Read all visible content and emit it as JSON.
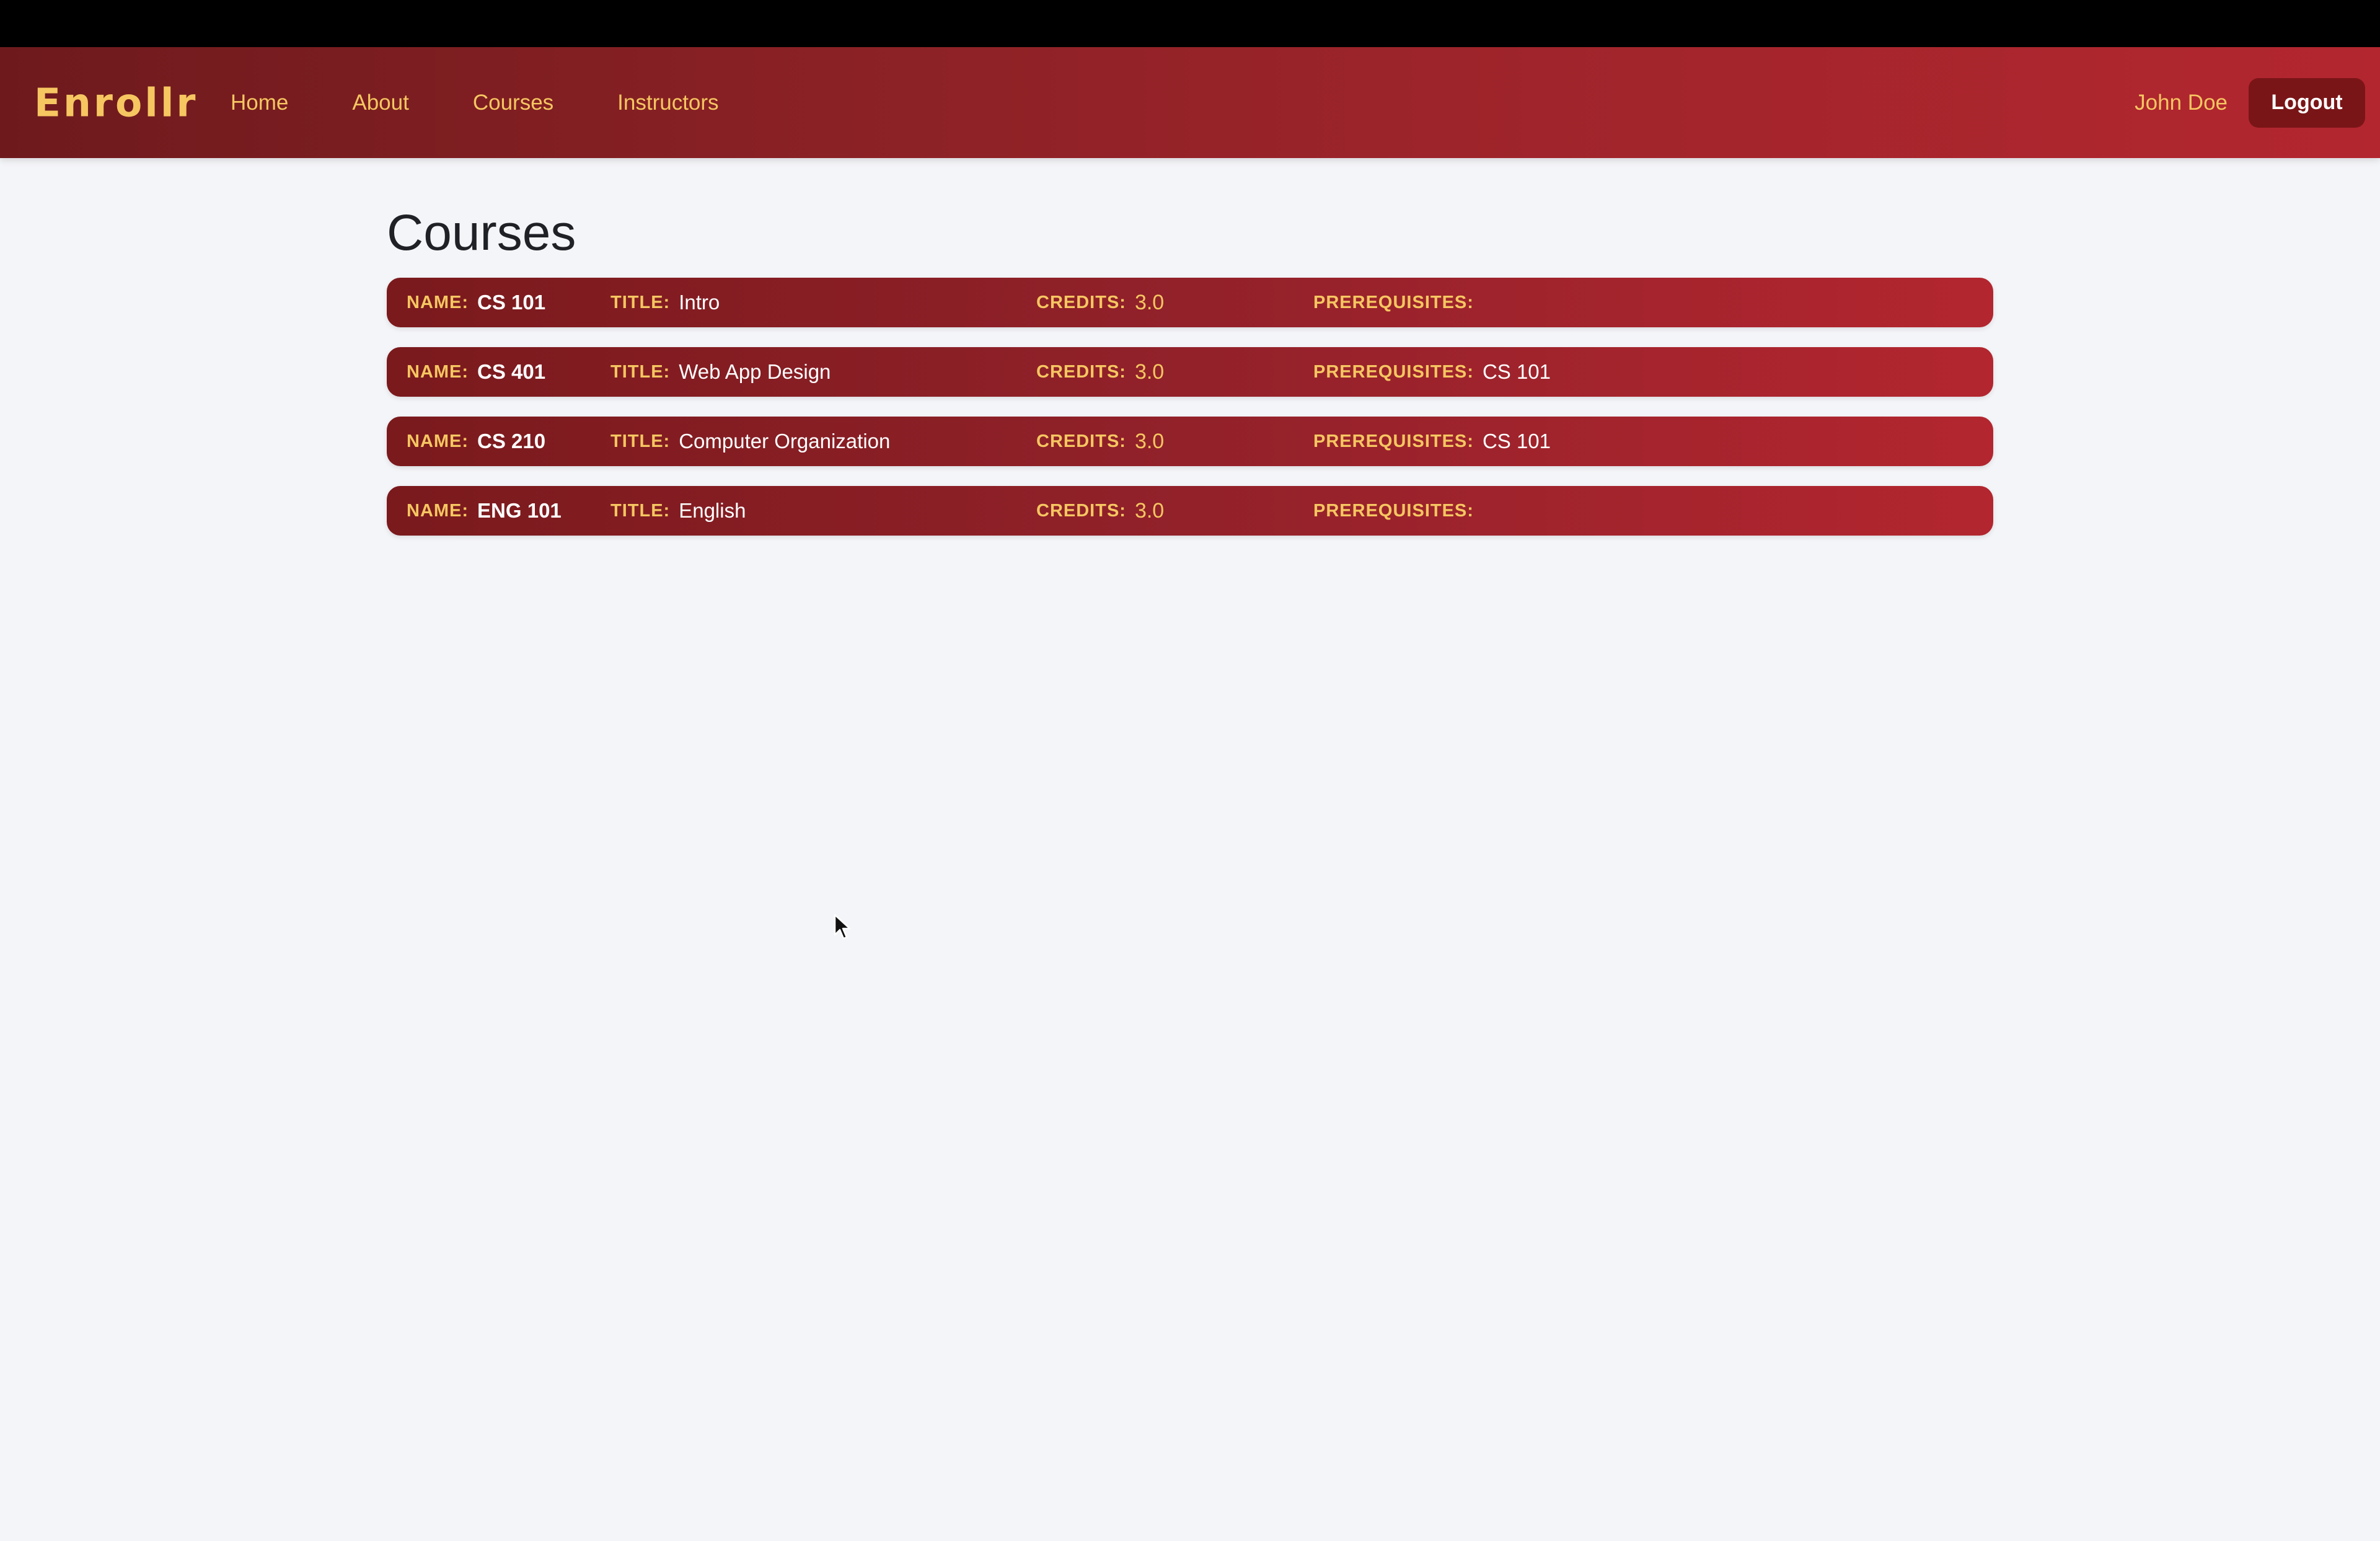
{
  "nav": {
    "brand": "Enrollr",
    "links": [
      "Home",
      "About",
      "Courses",
      "Instructors"
    ],
    "user_name": "John Doe",
    "logout_label": "Logout"
  },
  "main": {
    "title": "Courses",
    "labels": {
      "name": "NAME:",
      "title": "TITLE:",
      "credits": "CREDITS:",
      "prerequisites": "PREREQUISITES:"
    },
    "courses": [
      {
        "name": "CS 101",
        "title": "Intro",
        "credits": "3.0",
        "prerequisites": ""
      },
      {
        "name": "CS 401",
        "title": "Web App Design",
        "credits": "3.0",
        "prerequisites": "CS 101"
      },
      {
        "name": "CS 210",
        "title": "Computer Organization",
        "credits": "3.0",
        "prerequisites": "CS 101"
      },
      {
        "name": "ENG 101",
        "title": "English",
        "credits": "3.0",
        "prerequisites": ""
      }
    ]
  },
  "colors": {
    "accent_gold": "#f6c661",
    "nav_start": "#6e1a1d",
    "nav_end": "#b3262f",
    "logout_bg": "#7a1517",
    "page_bg": "#f4f5f8"
  },
  "icons": {
    "cursor": "mouse-pointer-icon"
  }
}
